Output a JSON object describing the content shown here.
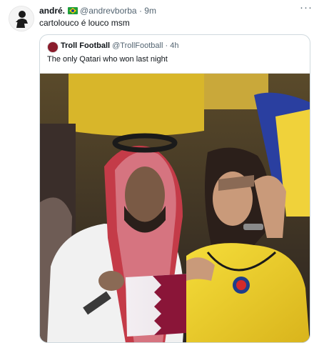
{
  "tweet": {
    "author_name": "andré.",
    "author_handle": "@andrevborba",
    "separator": "·",
    "time": "9m",
    "text": "cartolouco é louco msm",
    "flag_icon": "brazil-flag-icon",
    "more_icon": "more-options-icon",
    "more_label": "···"
  },
  "quoted_tweet": {
    "author_name": "Troll Football",
    "author_handle": "@TrollFootball",
    "separator": "·",
    "time": "4h",
    "text": "The only Qatari who won last night",
    "media_icon": "photo"
  },
  "colors": {
    "name": "#0f1419",
    "meta": "#536471",
    "border": "#cfd9de",
    "colombia_yellow": "#f2d22e",
    "qatar_maroon": "#8a1538"
  }
}
